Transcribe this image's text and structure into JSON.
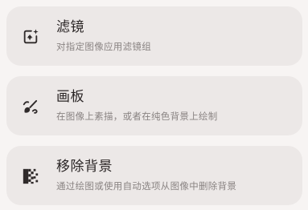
{
  "items": [
    {
      "title": "滤镜",
      "subtitle": "对指定图像应用滤镜组",
      "icon": "filter-sparkle-icon"
    },
    {
      "title": "画板",
      "subtitle": "在图像上素描，或者在纯色背景上绘制",
      "icon": "brush-draw-icon"
    },
    {
      "title": "移除背景",
      "subtitle": "通过绘图或使用自动选项从图像中删除背景",
      "icon": "checkerboard-erase-icon"
    }
  ],
  "colors": {
    "background": "#f7f4f3",
    "card": "#ece8e7",
    "title": "#2a2525",
    "subtitle": "#8a8483"
  }
}
